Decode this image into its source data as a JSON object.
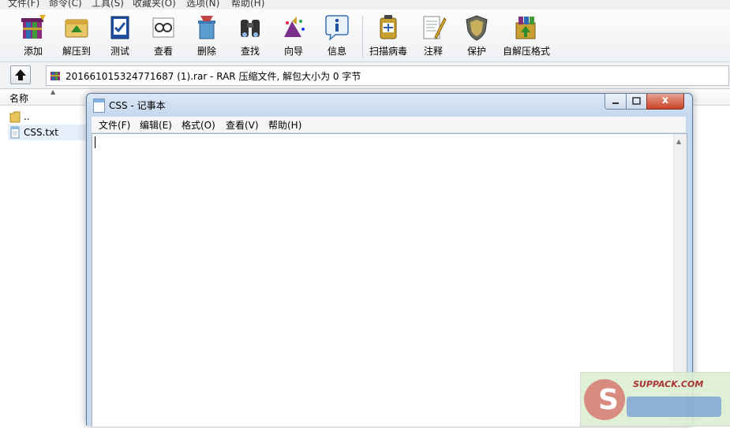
{
  "menubar": {
    "items": [
      "文件(F)",
      "命令(C)",
      "工具(S)",
      "收藏夹(O)",
      "选项(N)",
      "帮助(H)"
    ]
  },
  "toolbar": {
    "buttons": [
      {
        "label": "添加",
        "icon": "add-archive-icon"
      },
      {
        "label": "解压到",
        "icon": "extract-to-icon"
      },
      {
        "label": "测试",
        "icon": "test-icon"
      },
      {
        "label": "查看",
        "icon": "view-icon"
      },
      {
        "label": "删除",
        "icon": "delete-icon"
      },
      {
        "label": "查找",
        "icon": "find-icon"
      },
      {
        "label": "向导",
        "icon": "wizard-icon"
      },
      {
        "label": "信息",
        "icon": "info-icon"
      },
      {
        "label": "扫描病毒",
        "icon": "virus-scan-icon"
      },
      {
        "label": "注释",
        "icon": "comment-icon"
      },
      {
        "label": "保护",
        "icon": "protect-icon"
      },
      {
        "label": "自解压格式",
        "icon": "sfx-icon"
      }
    ]
  },
  "addressbar": {
    "path": "201661015324771687 (1).rar - RAR 压缩文件, 解包大小为 0 字节"
  },
  "filelist": {
    "column_name": "名称",
    "rows": [
      {
        "name": "..",
        "icon": "folder-icon"
      },
      {
        "name": "CSS.txt",
        "icon": "text-file-icon"
      }
    ]
  },
  "notepad": {
    "title": "CSS - 记事本",
    "menu": [
      "文件(F)",
      "编辑(E)",
      "格式(O)",
      "查看(V)",
      "帮助(H)"
    ],
    "close_glyph": "x"
  },
  "watermark": {
    "text": "SUPPACK.COM"
  },
  "colors": {
    "notepad_frame": "#c7d9ee",
    "close_button": "#c8432a",
    "toolbar_bg": "#eef0f3"
  }
}
